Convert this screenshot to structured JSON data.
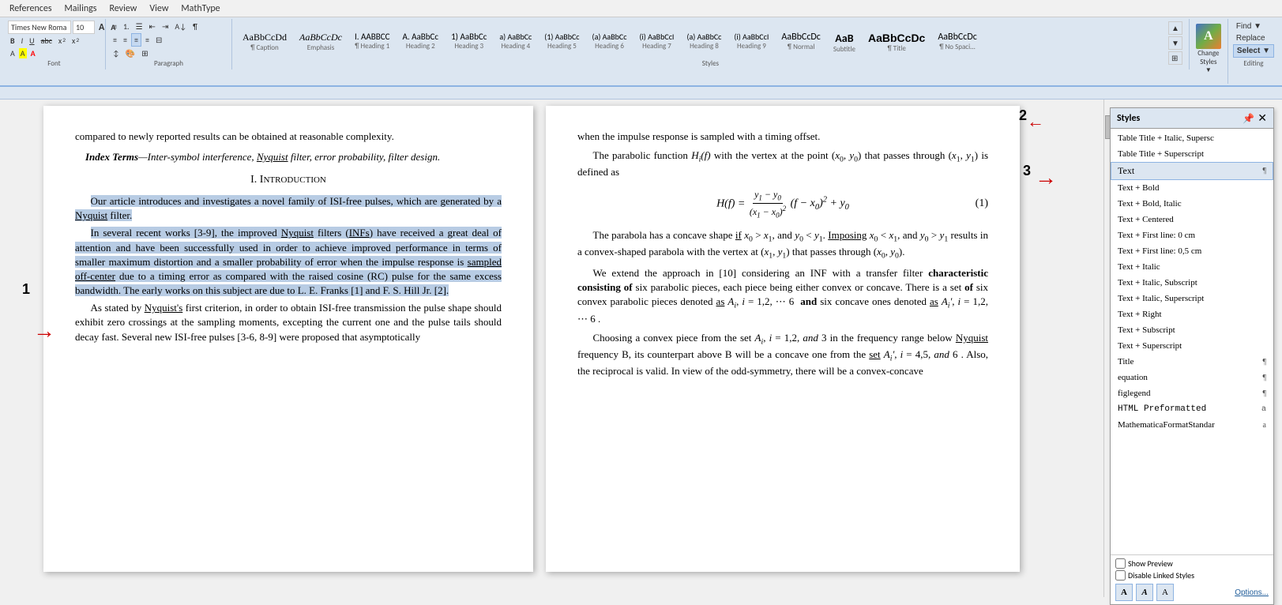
{
  "menu": {
    "items": [
      "References",
      "Mailings",
      "Review",
      "View",
      "MathType"
    ]
  },
  "ribbon": {
    "font_group_label": "Font",
    "paragraph_group_label": "Paragraph",
    "styles_group_label": "Styles",
    "editing_group_label": "Editing",
    "styles_items": [
      {
        "label": "AaBbCcDd",
        "sublabel": "¶ Caption",
        "class": "normal"
      },
      {
        "label": "AaBbCcDc",
        "sublabel": "Emphasis",
        "class": "italic"
      },
      {
        "label": "I. AABBCC",
        "sublabel": "¶ Heading 1",
        "class": "h1"
      },
      {
        "label": "A. AaBbCc",
        "sublabel": "Heading 2",
        "class": "normal"
      },
      {
        "label": "1) AaBbCc",
        "sublabel": "Heading 3",
        "class": "normal"
      },
      {
        "label": "a) AaBbCc",
        "sublabel": "(1) AaBbCc",
        "class": "normal"
      },
      {
        "label": "(a) AaBbCc",
        "sublabel": "Heading 5",
        "class": "normal"
      },
      {
        "label": "(i) AaBbCcI",
        "sublabel": "Heading 6",
        "class": "normal"
      },
      {
        "label": "(a) AaBbCc",
        "sublabel": "Heading 7",
        "class": "normal"
      },
      {
        "label": "(i) AaBbCcI",
        "sublabel": "Heading 8",
        "class": "normal"
      },
      {
        "label": "AaBbCcDc",
        "sublabel": "Heading 9",
        "class": "normal"
      },
      {
        "label": "AaBbCcI",
        "sublabel": "¶ Normal",
        "class": "normal"
      },
      {
        "label": "AaB",
        "sublabel": "Subtitle",
        "class": "subtitle"
      },
      {
        "label": "AaBbCcDc",
        "sublabel": "¶ Title",
        "class": "title"
      },
      {
        "label": "AaBbCcDc",
        "sublabel": "¶ No Spaci...",
        "class": "normal"
      }
    ],
    "change_styles_label": "Change\nStyles",
    "find_label": "Find ▼",
    "replace_label": "Replace",
    "select_label": "Select ▼",
    "editing_number": "2"
  },
  "document": {
    "left_page": {
      "intro_text": "compared to newly reported results can be obtained at reasonable complexity.",
      "index_terms_label": "Index Terms",
      "index_terms_content": "—Inter-symbol interference, Nyquist filter, error probability, filter design.",
      "section_heading": "I. Introduction",
      "para1": "Our article introduces and investigates a novel family of ISI-free pulses, which are generated by a Nyquist filter.",
      "para2": "In several recent works [3-9], the improved Nyquist filters (INFs) have received a great deal of attention and have been successfully used in order to achieve improved performance in terms of smaller maximum distortion and a smaller probability of error when the impulse response is sampled off-center due to a timing error as compared with the raised cosine (RC) pulse for the same excess bandwidth. The early works on this subject are due to L. E. Franks [1] and F. S. Hill Jr. [2].",
      "para3": "As stated by Nyquist's first criterion, in order to obtain ISI-free transmission the pulse shape should exhibit zero crossings at the sampling moments, excepting the current one and the pulse tails should decay fast. Several new ISI-free pulses [3-6, 8-9] were proposed that asymptotically"
    },
    "right_page": {
      "para1": "when the impulse response is sampled with a timing offset.",
      "para2_prefix": "The parabolic function ",
      "para2_math": "H_i(f)",
      "para2_suffix": " with the vertex at the point",
      "para3": "(x₀, y₀) that passes through (x₁, y₁) is defined as",
      "formula_lhs": "H(f) =",
      "formula_frac_num": "y₁ − y₀",
      "formula_frac_den": "(x₁ − x₀)²",
      "formula_rhs": "(f − x₀)² + y₀",
      "formula_number": "(1)",
      "para4": "The parabola has a concave shape if x₀ > x₁, and y₀ < y₁. Imposing x₀ < x₁, and y₀ > y₁ results in a convex-shaped parabola with the vertex at (x₁, y₁) that passes through (x₀, y₀).",
      "para5": "We extend the approach in [10] considering an INF with a transfer filter characteristic consisting of six parabolic pieces, each piece being either convex or concave. There is a set of six convex parabolic pieces denoted as A_i, i = 1,2,⋯6 and six concave ones denoted as A_i', i = 1,2,⋯6.",
      "para6": "Choosing a convex piece from the set A_i, i = 1,2, and 3 in the frequency range below Nyquist frequency B, its counterpart above B will be a concave one from the set A_i', i = 4,5, and 6. Also, the reciprocal is valid. In view of the odd-symmetry, there will be a convex-concave"
    }
  },
  "styles_panel": {
    "title": "Styles",
    "items": [
      {
        "label": "Table Title + Italic, Supersc",
        "mark": "",
        "active": false
      },
      {
        "label": "Table Title + Superscript",
        "mark": "",
        "active": false
      },
      {
        "label": "Text",
        "mark": "¶",
        "active": true
      },
      {
        "label": "Text + Bold",
        "mark": "",
        "active": false
      },
      {
        "label": "Text + Bold, Italic",
        "mark": "",
        "active": false
      },
      {
        "label": "Text + Centered",
        "mark": "",
        "active": false
      },
      {
        "label": "Text + First line: 0 cm",
        "mark": "",
        "active": false
      },
      {
        "label": "Text + First line: 0,5 cm",
        "mark": "",
        "active": false
      },
      {
        "label": "Text + Italic",
        "mark": "",
        "active": false
      },
      {
        "label": "Text + Italic, Subscript",
        "mark": "",
        "active": false
      },
      {
        "label": "Text + Italic, Superscript",
        "mark": "",
        "active": false
      },
      {
        "label": "Text + Right",
        "mark": "",
        "active": false
      },
      {
        "label": "Text + Subscript",
        "mark": "",
        "active": false
      },
      {
        "label": "Text + Superscript",
        "mark": "",
        "active": false
      },
      {
        "label": "Title",
        "mark": "¶",
        "active": false
      },
      {
        "label": "equation",
        "mark": "¶",
        "active": false
      },
      {
        "label": "figlegend",
        "mark": "¶",
        "active": false
      },
      {
        "label": "HTML Preformatted",
        "mark": "a",
        "active": false
      },
      {
        "label": "MathematicaFormatStandar",
        "mark": "a",
        "active": false
      }
    ],
    "show_preview_label": "Show Preview",
    "disable_linked_label": "Disable Linked Styles",
    "options_label": "Options...",
    "btn1": "A",
    "btn2": "A",
    "btn3": "A"
  },
  "annotations": {
    "num1": "1",
    "num2": "2",
    "num3": "3",
    "arrow": "→"
  }
}
